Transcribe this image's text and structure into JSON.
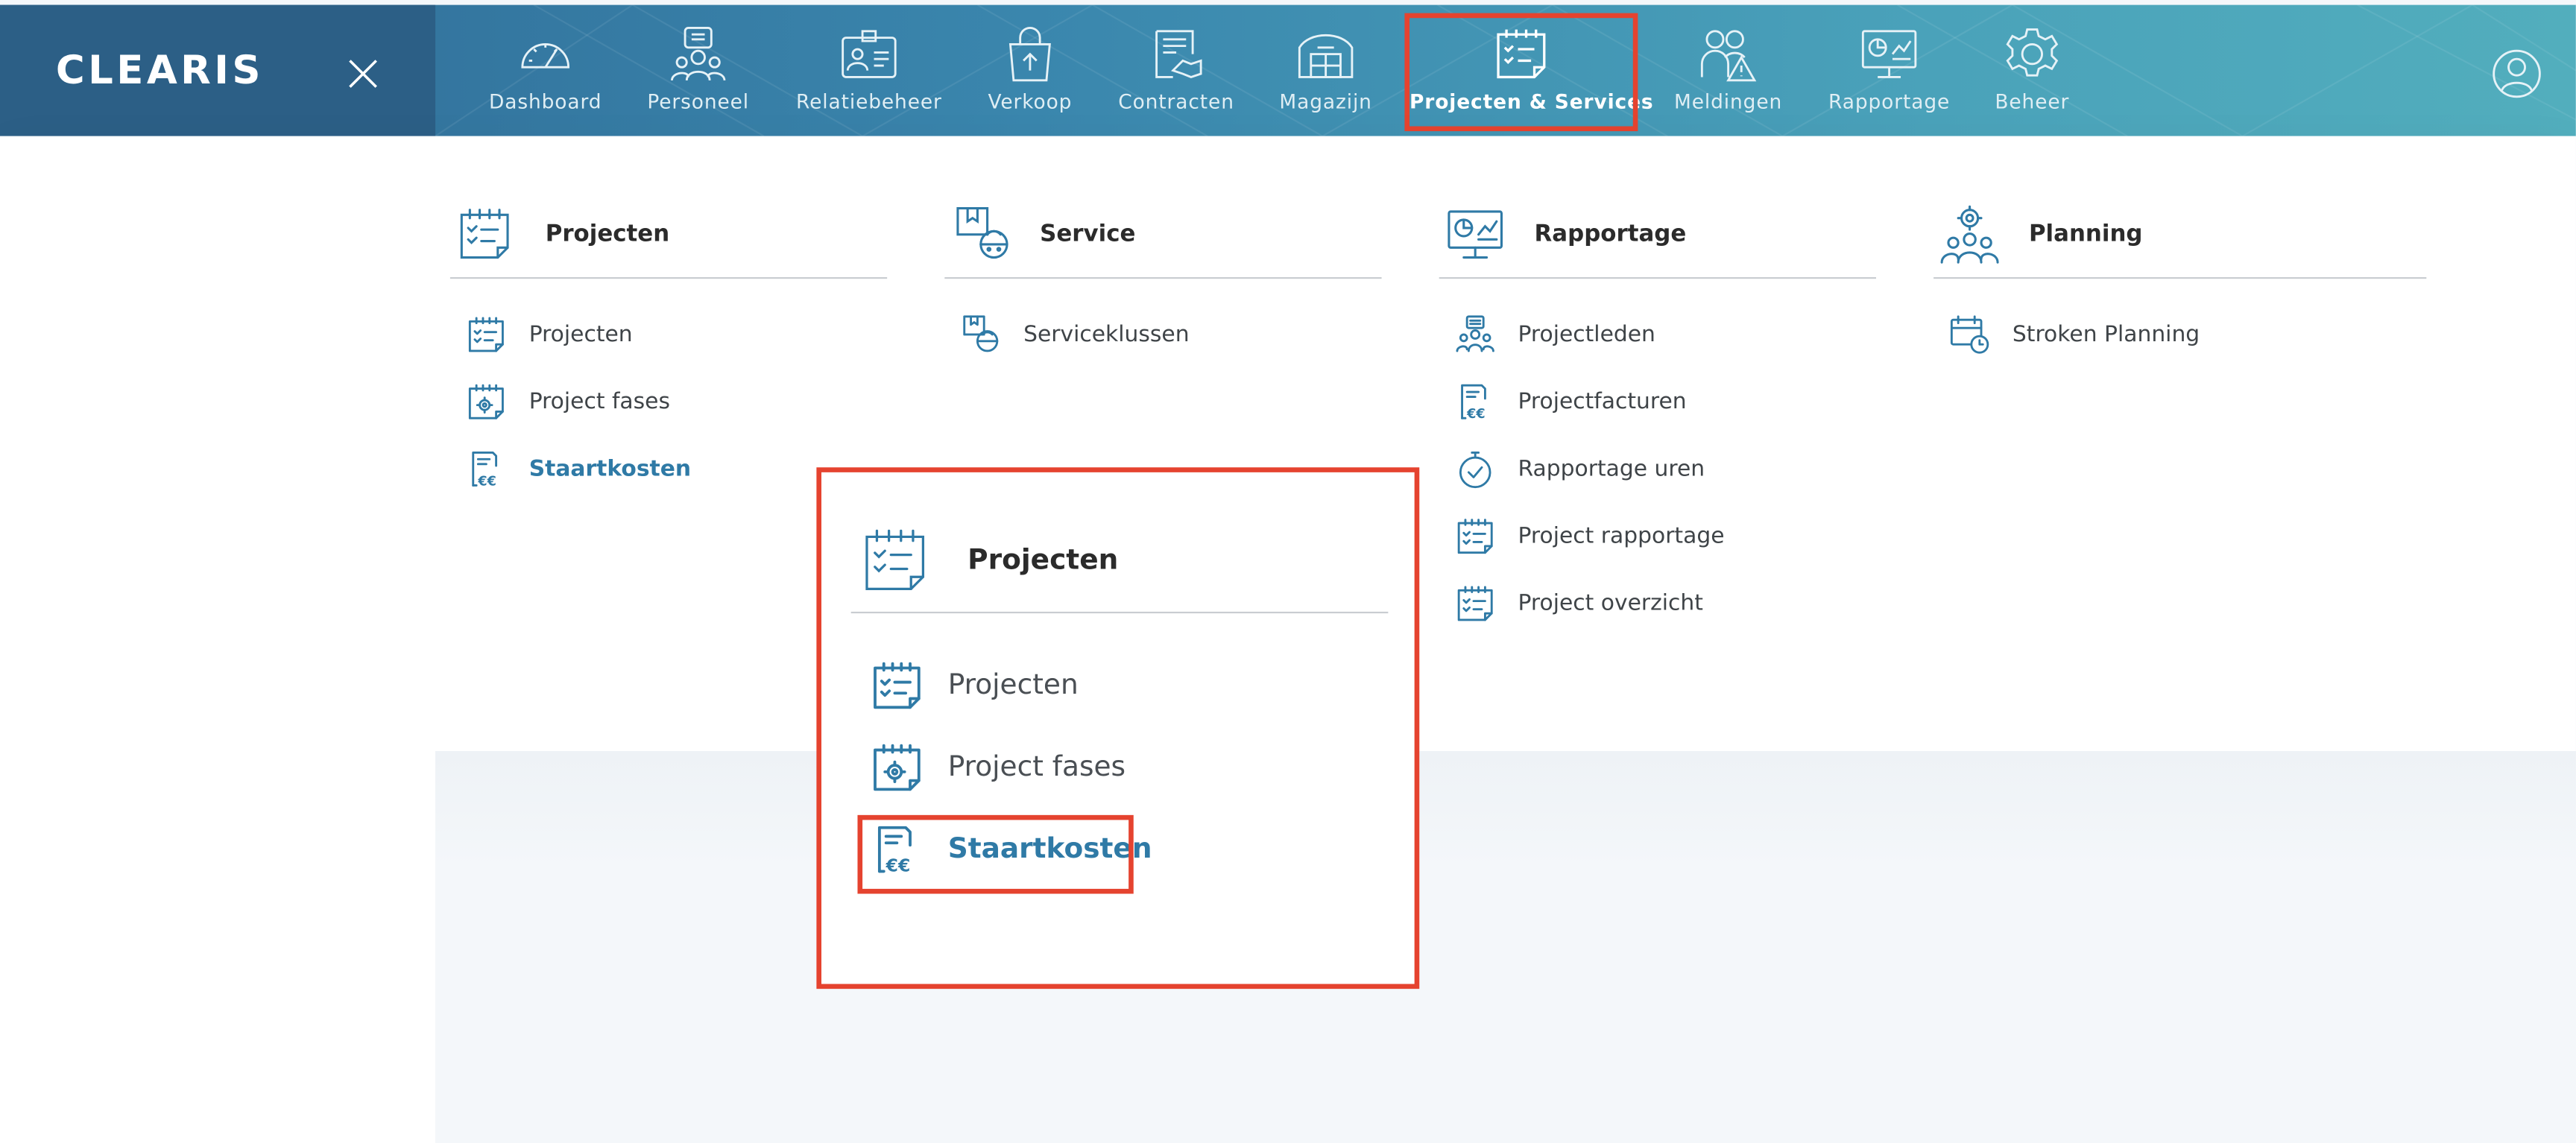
{
  "brand": {
    "name": "CLEARIS"
  },
  "nav": {
    "items": [
      {
        "label": "Dashboard",
        "icon": "speedometer-icon"
      },
      {
        "label": "Personeel",
        "icon": "people-icon"
      },
      {
        "label": "Relatiebeheer",
        "icon": "contact-card-icon"
      },
      {
        "label": "Verkoop",
        "icon": "shopping-bag-icon"
      },
      {
        "label": "Contracten",
        "icon": "contract-handshake-icon"
      },
      {
        "label": "Magazijn",
        "icon": "warehouse-icon"
      },
      {
        "label": "Projecten & Services",
        "icon": "checklist-icon",
        "active": true
      },
      {
        "label": "Meldingen",
        "icon": "people-warning-icon"
      },
      {
        "label": "Rapportage",
        "icon": "monitor-chart-icon"
      },
      {
        "label": "Beheer",
        "icon": "gear-icon"
      }
    ]
  },
  "menu": {
    "projecten": {
      "title": "Projecten",
      "items": [
        {
          "label": "Projecten"
        },
        {
          "label": "Project fases"
        },
        {
          "label": "Staartkosten",
          "active": true
        }
      ]
    },
    "service": {
      "title": "Service",
      "items": [
        {
          "label": "Serviceklussen"
        }
      ]
    },
    "rapportage": {
      "title": "Rapportage",
      "items": [
        {
          "label": "Projectleden"
        },
        {
          "label": "Projectfacturen"
        },
        {
          "label": "Rapportage uren"
        },
        {
          "label": "Project rapportage"
        },
        {
          "label": "Project overzicht"
        }
      ]
    },
    "planning": {
      "title": "Planning",
      "items": [
        {
          "label": "Stroken Planning"
        }
      ]
    }
  },
  "zoom": {
    "title": "Projecten",
    "items": [
      {
        "label": "Projecten"
      },
      {
        "label": "Project fases"
      },
      {
        "label": "Staartkosten",
        "active": true
      }
    ]
  },
  "colors": {
    "accent": "#2f7aa6",
    "highlight": "#e5432f",
    "topbar_start": "#2f6a95",
    "topbar_end": "#52aebd"
  }
}
